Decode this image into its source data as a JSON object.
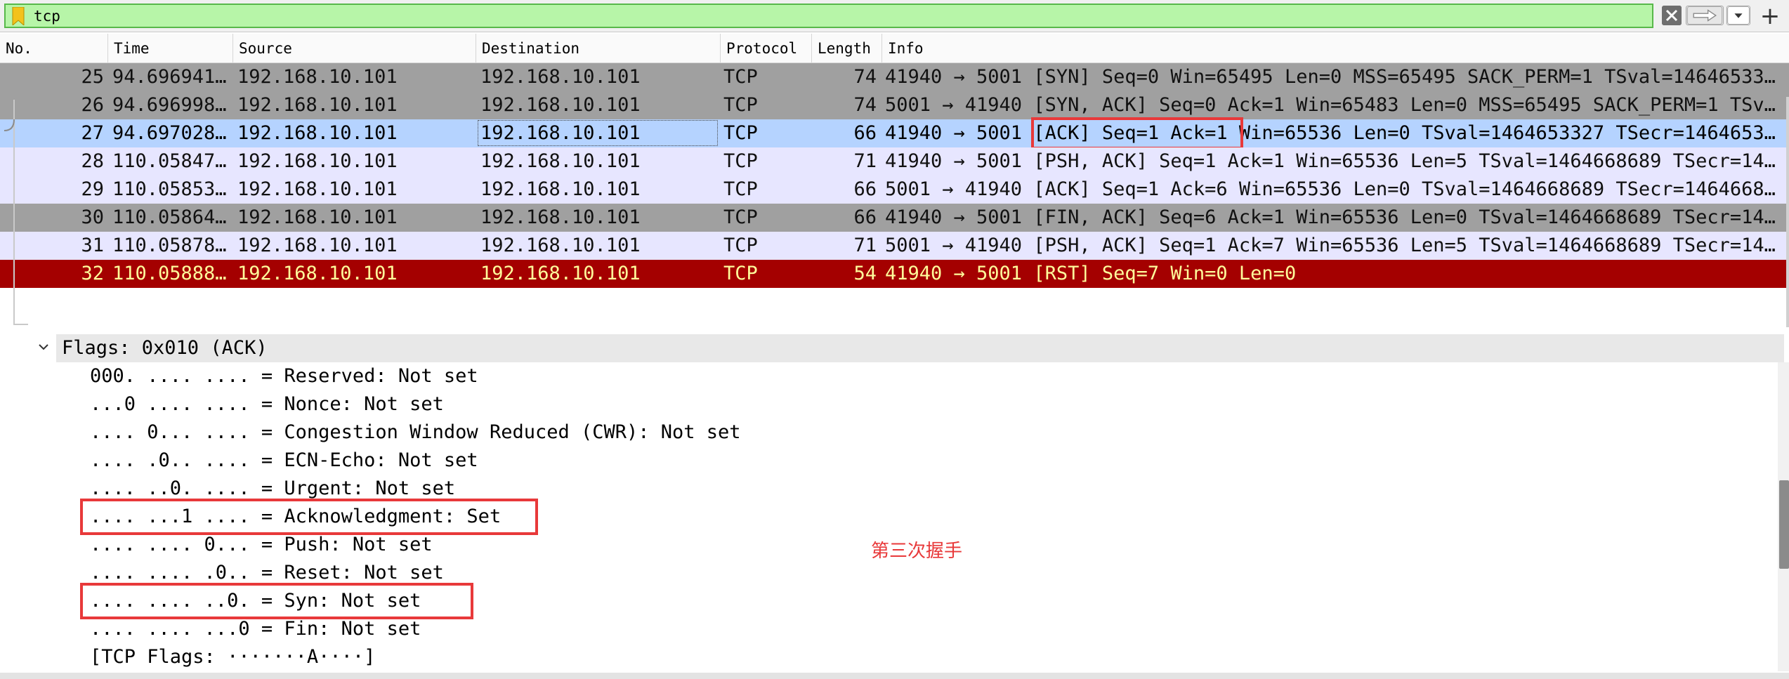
{
  "filter": {
    "value": "tcp"
  },
  "columns": [
    "No.",
    "Time",
    "Source",
    "Destination",
    "Protocol",
    "Length",
    "Info"
  ],
  "packets": [
    {
      "no": "25",
      "time": "94.696941…",
      "src": "192.168.10.101",
      "dst": "192.168.10.101",
      "proto": "TCP",
      "len": "74",
      "info": "41940 → 5001 [SYN] Seq=0 Win=65495 Len=0 MSS=65495 SACK_PERM=1 TSval=14646533…"
    },
    {
      "no": "26",
      "time": "94.696998…",
      "src": "192.168.10.101",
      "dst": "192.168.10.101",
      "proto": "TCP",
      "len": "74",
      "info": "5001 → 41940 [SYN, ACK] Seq=0 Ack=1 Win=65483 Len=0 MSS=65495 SACK_PERM=1 TSv…"
    },
    {
      "no": "27",
      "time": "94.697028…",
      "src": "192.168.10.101",
      "dst": "192.168.10.101",
      "proto": "TCP",
      "len": "66",
      "info": "41940 → 5001 [ACK] Seq=1 Ack=1 Win=65536 Len=0 TSval=1464653327 TSecr=1464653…"
    },
    {
      "no": "28",
      "time": "110.05847…",
      "src": "192.168.10.101",
      "dst": "192.168.10.101",
      "proto": "TCP",
      "len": "71",
      "info": "41940 → 5001 [PSH, ACK] Seq=1 Ack=1 Win=65536 Len=5 TSval=1464668689 TSecr=14…"
    },
    {
      "no": "29",
      "time": "110.05853…",
      "src": "192.168.10.101",
      "dst": "192.168.10.101",
      "proto": "TCP",
      "len": "66",
      "info": "5001 → 41940 [ACK] Seq=1 Ack=6 Win=65536 Len=0 TSval=1464668689 TSecr=1464668…"
    },
    {
      "no": "30",
      "time": "110.05864…",
      "src": "192.168.10.101",
      "dst": "192.168.10.101",
      "proto": "TCP",
      "len": "66",
      "info": "41940 → 5001 [FIN, ACK] Seq=6 Ack=1 Win=65536 Len=0 TSval=1464668689 TSecr=14…"
    },
    {
      "no": "31",
      "time": "110.05878…",
      "src": "192.168.10.101",
      "dst": "192.168.10.101",
      "proto": "TCP",
      "len": "71",
      "info": "5001 → 41940 [PSH, ACK] Seq=1 Ack=7 Win=65536 Len=5 TSval=1464668689 TSecr=14…"
    },
    {
      "no": "32",
      "time": "110.05888…",
      "src": "192.168.10.101",
      "dst": "192.168.10.101",
      "proto": "TCP",
      "len": "54",
      "info": "41940 → 5001 [RST] Seq=7 Win=0 Len=0"
    }
  ],
  "row_colors": {
    "syn_bg": "#a0a0a0",
    "selected_bg": "#b5d3ff",
    "normal_bg": "#e7e6ff",
    "fin_bg": "#a0a0a0",
    "rst_bg": "#a40000",
    "rst_fg": "#fffc9c",
    "annotation": "#e8393a"
  },
  "details": {
    "flags_header": "Flags: 0x010 (ACK)",
    "lines": [
      "000. .... .... = Reserved: Not set",
      "...0 .... .... = Nonce: Not set",
      ".... 0... .... = Congestion Window Reduced (CWR): Not set",
      ".... .0.. .... = ECN-Echo: Not set",
      ".... ..0. .... = Urgent: Not set",
      ".... ...1 .... = Acknowledgment: Set",
      ".... .... 0... = Push: Not set",
      ".... .... .0.. = Reset: Not set",
      ".... .... ..0. = Syn: Not set",
      ".... .... ...0 = Fin: Not set",
      "[TCP Flags: ·······A····]"
    ],
    "annotation_text": "第三次握手"
  }
}
